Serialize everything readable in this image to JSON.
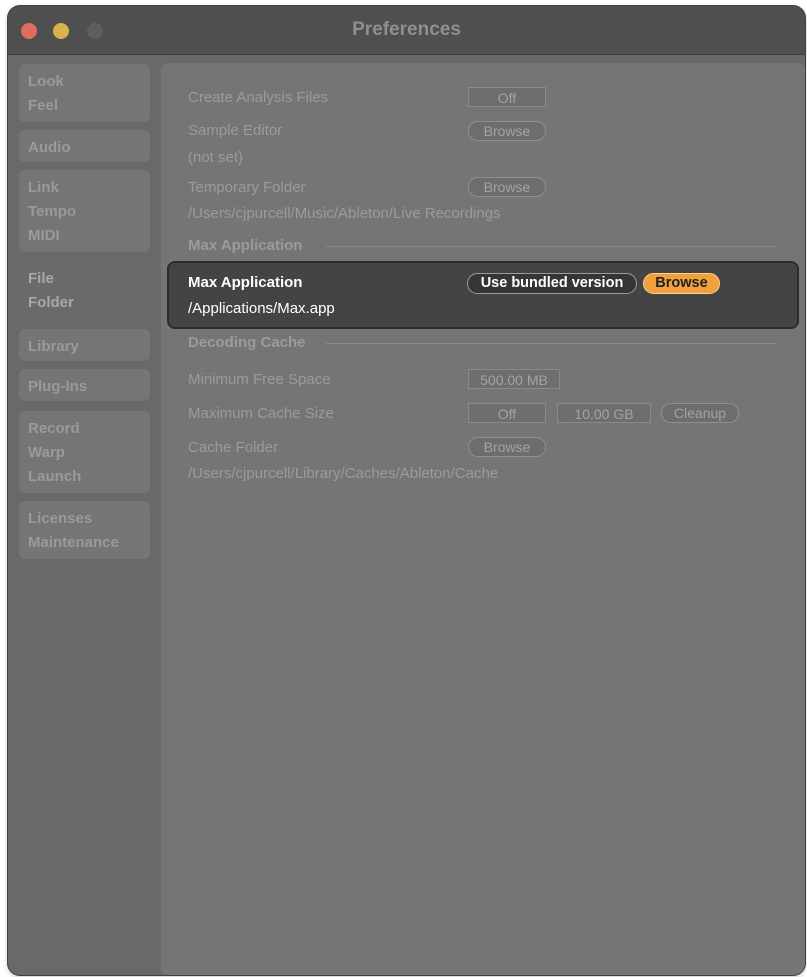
{
  "window": {
    "title": "Preferences"
  },
  "sidebar": {
    "groups": [
      {
        "lines": [
          "Look",
          "Feel"
        ]
      },
      {
        "lines": [
          "Audio"
        ]
      },
      {
        "lines": [
          "Link",
          "Tempo",
          "MIDI"
        ]
      },
      {
        "lines": [
          "File",
          "Folder"
        ],
        "active": true
      },
      {
        "lines": [
          "Library"
        ]
      },
      {
        "lines": [
          "Plug-Ins"
        ]
      },
      {
        "lines": [
          "Record",
          "Warp",
          "Launch"
        ]
      },
      {
        "lines": [
          "Licenses",
          "Maintenance"
        ]
      }
    ]
  },
  "file": {
    "create_analysis": {
      "label": "Create Analysis Files",
      "value": "Off"
    },
    "sample_editor": {
      "label": "Sample Editor",
      "button": "Browse",
      "path": "(not set)"
    },
    "temp_folder": {
      "label": "Temporary Folder",
      "button": "Browse",
      "path": "/Users/cjpurcell/Music/Ableton/Live Recordings"
    }
  },
  "max_section": {
    "title": "Max Application",
    "label": "Max Application",
    "bundled_button": "Use bundled version",
    "browse_button": "Browse",
    "path": "/Applications/Max.app",
    "accent_color": "#f0a03c"
  },
  "decoding": {
    "title": "Decoding Cache",
    "min_free": {
      "label": "Minimum Free Space",
      "value": "500.00 MB"
    },
    "max_cache": {
      "label": "Maximum Cache Size",
      "value": "Off",
      "size": "10.00 GB",
      "cleanup": "Cleanup"
    },
    "cache_folder": {
      "label": "Cache Folder",
      "button": "Browse",
      "path": "/Users/cjpurcell/Library/Caches/Ableton/Cache"
    }
  }
}
